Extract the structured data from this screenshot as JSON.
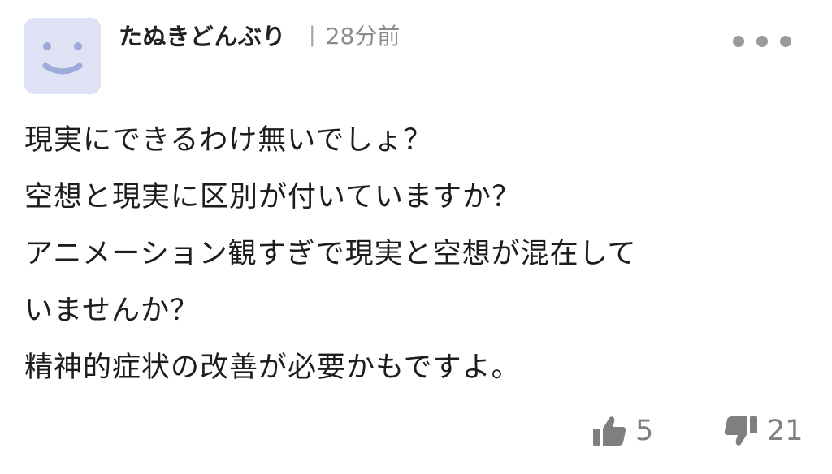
{
  "comment": {
    "author": {
      "name": "たぬきどんぶり",
      "avatar_icon": "smiley-face-icon",
      "avatar_bg": "#dfe2f5",
      "avatar_face_color": "#9eaad9"
    },
    "separator": "|",
    "time_ago": "28分前",
    "more_icon": "more-dots-icon",
    "body_lines": [
      "現実にできるわけ無いでしょ？",
      "空想と現実に区別が付いていますか？",
      "アニメーション観すぎで現実と空想が混在して",
      "いませんか？",
      "精神的症状の改善が必要かもですよ。"
    ],
    "reactions": {
      "like": {
        "icon": "thumbs-up-icon",
        "count": "5"
      },
      "dislike": {
        "icon": "thumbs-down-icon",
        "count": "21"
      },
      "icon_color": "#7f7f7f"
    }
  }
}
